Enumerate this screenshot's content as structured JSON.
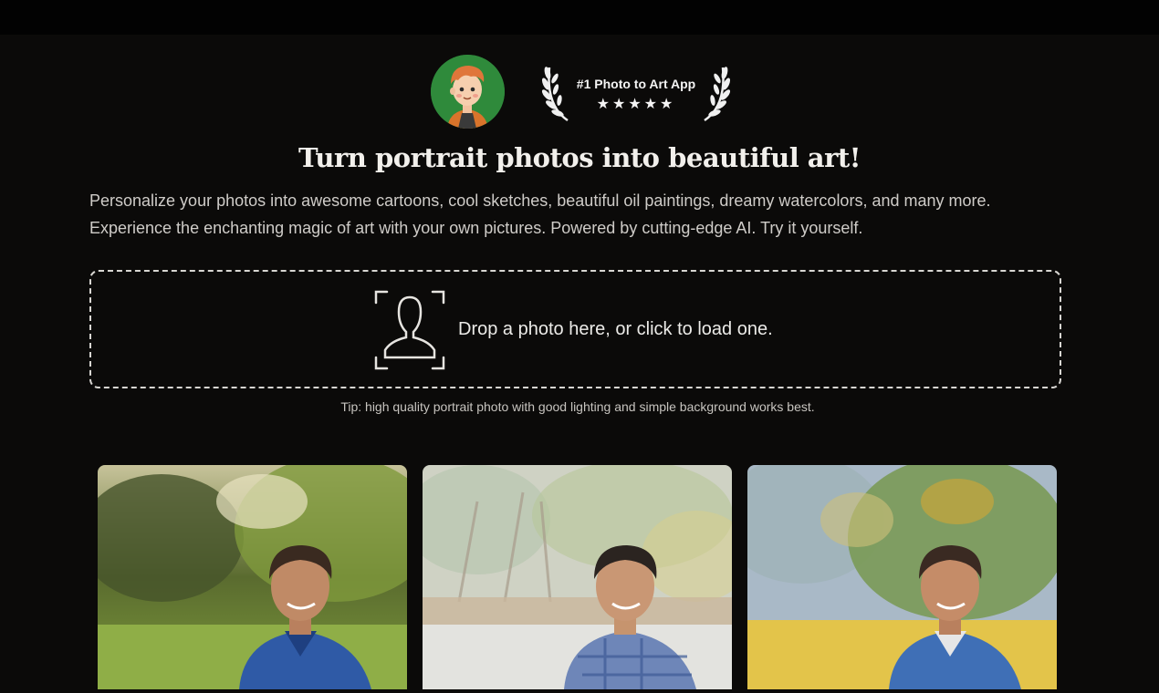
{
  "award": {
    "title": "#1 Photo to Art App",
    "stars": "★★★★★",
    "rating": 5
  },
  "headline": "Turn portrait photos into beautiful art!",
  "description": {
    "line1": "Personalize your photos into awesome cartoons, cool sketches, beautiful oil paintings, dreamy watercolors, and many more.",
    "line2": "Experience the enchanting magic of art with your own pictures. Powered by cutting-edge AI. Try it yourself."
  },
  "dropzone": {
    "label": "Drop a photo here, or click to load one.",
    "icon": "face-scan-icon"
  },
  "tip": "Tip: high quality portrait photo with good lighting and simple background works best.",
  "examples": [
    {
      "style": "original-photo"
    },
    {
      "style": "watercolor"
    },
    {
      "style": "oil-painting"
    }
  ],
  "colors": {
    "background": "#0b0a09",
    "topbar": "#020202",
    "avatar_bg": "#2f8a3b"
  }
}
